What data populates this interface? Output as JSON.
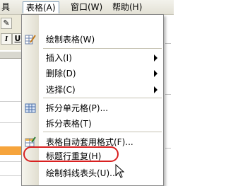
{
  "menubar": {
    "left_cut": "具",
    "table": "表格(A)",
    "window": "窗口(W)",
    "help": "帮助(H)"
  },
  "toolbar": {
    "italic": "I",
    "underline": "U"
  },
  "menu": {
    "items": [
      {
        "label": "绘制表格(W)",
        "icon": "pencil-icon"
      },
      {
        "label": "插入(I)",
        "submenu": true
      },
      {
        "label": "删除(D)",
        "submenu": true
      },
      {
        "label": "选择(C)",
        "submenu": true
      },
      {
        "label": "拆分单元格(P)...",
        "icon": "split-cells-icon"
      },
      {
        "label": "拆分表格(T)"
      },
      {
        "label": "表格自动套用格式(F)...",
        "icon": "autoformat-icon"
      },
      {
        "label": "标题行重复(H)",
        "highlighted": true
      },
      {
        "label": "绘制斜线表头(U)..."
      }
    ]
  },
  "colors": {
    "highlight_oval": "#d92020",
    "orange_row": "#f6a43c"
  }
}
